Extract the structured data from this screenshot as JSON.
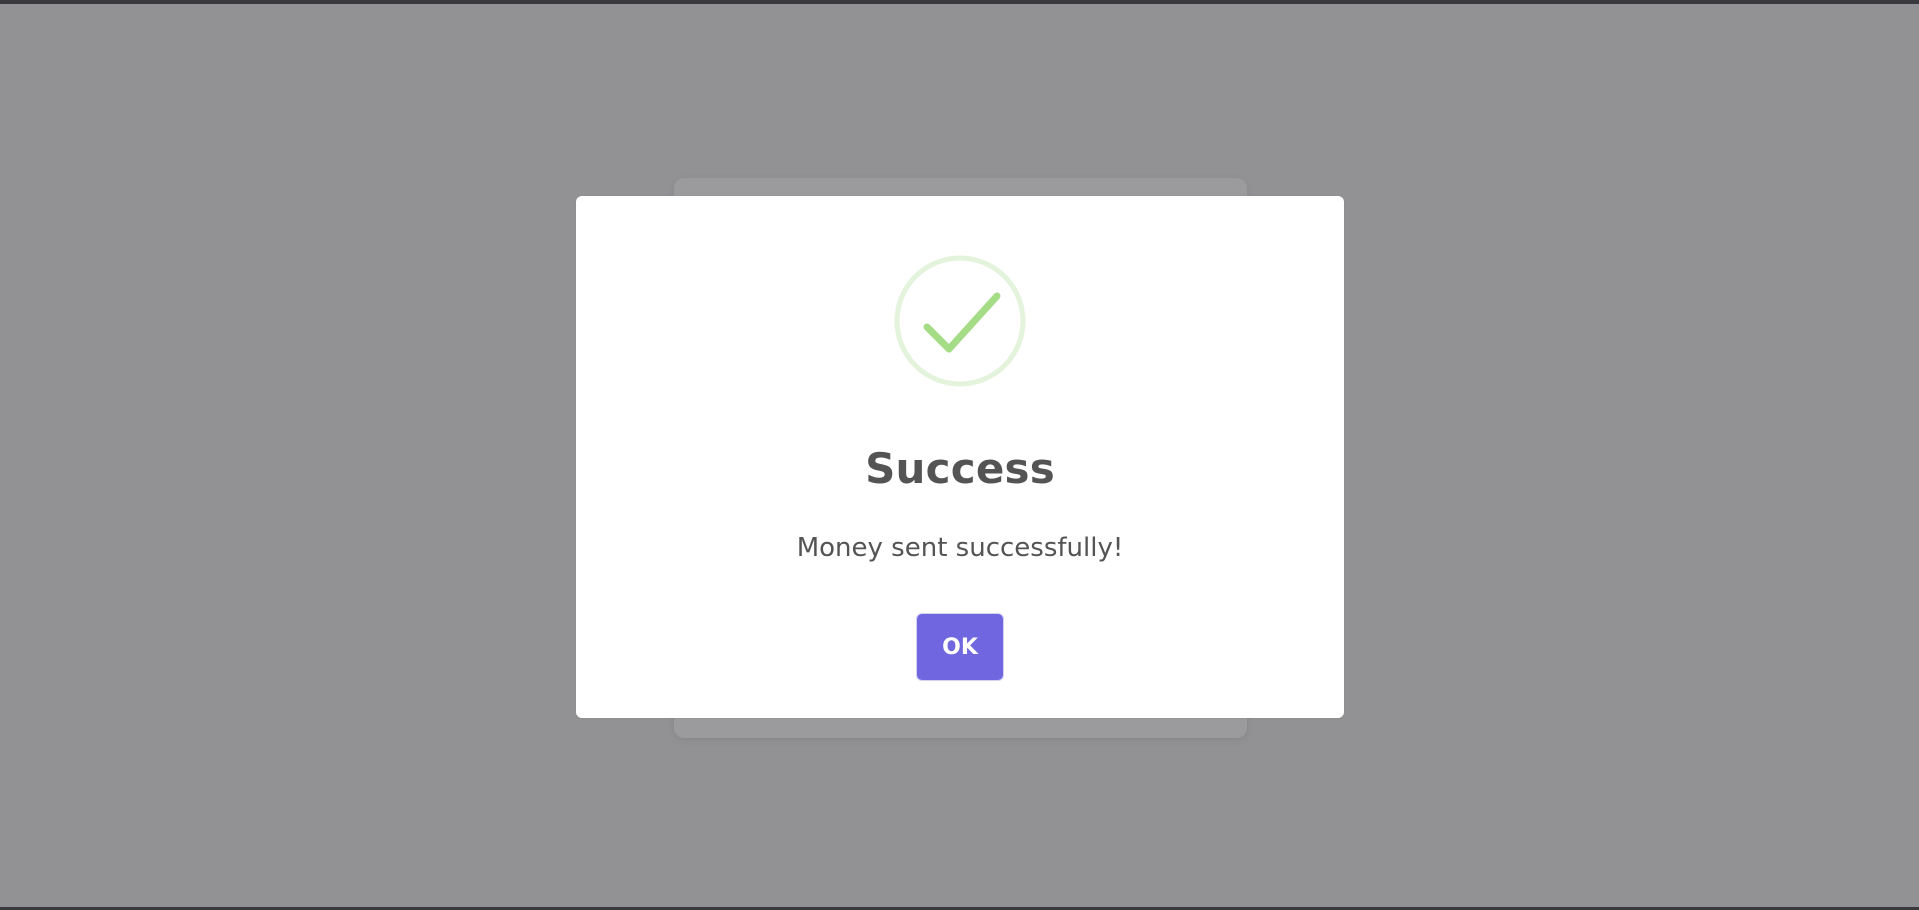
{
  "dialog": {
    "icon": "success-check-icon",
    "title": "Success",
    "message": "Money sent successfully!",
    "confirm_label": "OK"
  },
  "colors": {
    "overlay": "#929294",
    "modal_background": "#ffffff",
    "icon_ring": "#e4f3dc",
    "icon_check": "#a5dc86",
    "confirm_button": "#7066e0",
    "text": "#545454"
  }
}
